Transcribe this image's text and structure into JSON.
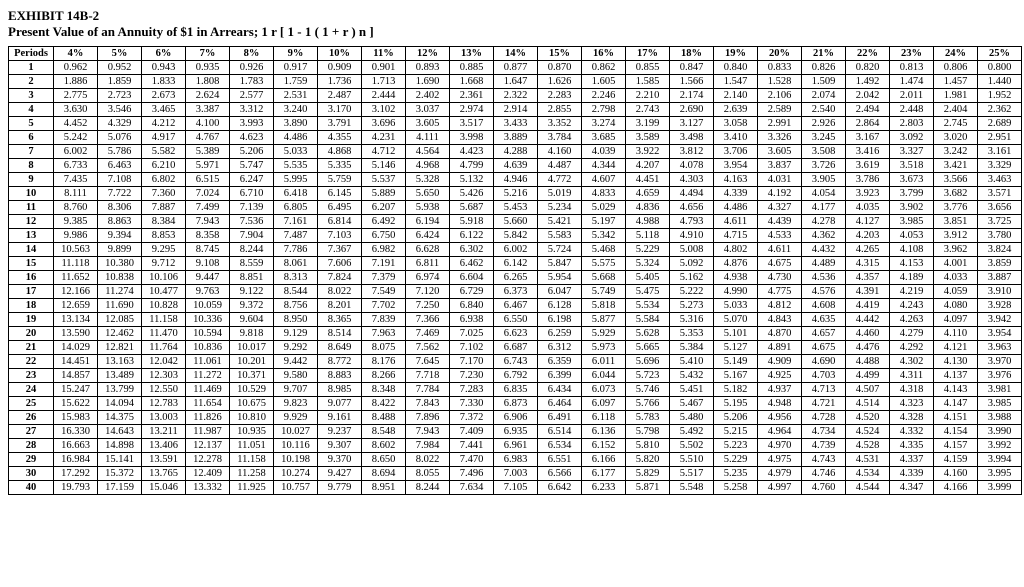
{
  "header": {
    "exhibit": "EXHIBIT 14B-2",
    "title": "Present Value of an Annuity of $1 in Arrears; 1 r [ 1 - 1 ( 1 + r ) n ]"
  },
  "table": {
    "periods_label": "Periods",
    "rates": [
      "4%",
      "5%",
      "6%",
      "7%",
      "8%",
      "9%",
      "10%",
      "11%",
      "12%",
      "13%",
      "14%",
      "15%",
      "16%",
      "17%",
      "18%",
      "19%",
      "20%",
      "21%",
      "22%",
      "23%",
      "24%",
      "25%"
    ],
    "periods": [
      1,
      2,
      3,
      4,
      5,
      6,
      7,
      8,
      9,
      10,
      11,
      12,
      13,
      14,
      15,
      16,
      17,
      18,
      19,
      20,
      21,
      22,
      23,
      24,
      25,
      26,
      27,
      28,
      29,
      30,
      40
    ],
    "rows": {
      "1": [
        "0.962",
        "0.952",
        "0.943",
        "0.935",
        "0.926",
        "0.917",
        "0.909",
        "0.901",
        "0.893",
        "0.885",
        "0.877",
        "0.870",
        "0.862",
        "0.855",
        "0.847",
        "0.840",
        "0.833",
        "0.826",
        "0.820",
        "0.813",
        "0.806",
        "0.800"
      ],
      "2": [
        "1.886",
        "1.859",
        "1.833",
        "1.808",
        "1.783",
        "1.759",
        "1.736",
        "1.713",
        "1.690",
        "1.668",
        "1.647",
        "1.626",
        "1.605",
        "1.585",
        "1.566",
        "1.547",
        "1.528",
        "1.509",
        "1.492",
        "1.474",
        "1.457",
        "1.440"
      ],
      "3": [
        "2.775",
        "2.723",
        "2.673",
        "2.624",
        "2.577",
        "2.531",
        "2.487",
        "2.444",
        "2.402",
        "2.361",
        "2.322",
        "2.283",
        "2.246",
        "2.210",
        "2.174",
        "2.140",
        "2.106",
        "2.074",
        "2.042",
        "2.011",
        "1.981",
        "1.952"
      ],
      "4": [
        "3.630",
        "3.546",
        "3.465",
        "3.387",
        "3.312",
        "3.240",
        "3.170",
        "3.102",
        "3.037",
        "2.974",
        "2.914",
        "2.855",
        "2.798",
        "2.743",
        "2.690",
        "2.639",
        "2.589",
        "2.540",
        "2.494",
        "2.448",
        "2.404",
        "2.362"
      ],
      "5": [
        "4.452",
        "4.329",
        "4.212",
        "4.100",
        "3.993",
        "3.890",
        "3.791",
        "3.696",
        "3.605",
        "3.517",
        "3.433",
        "3.352",
        "3.274",
        "3.199",
        "3.127",
        "3.058",
        "2.991",
        "2.926",
        "2.864",
        "2.803",
        "2.745",
        "2.689"
      ],
      "6": [
        "5.242",
        "5.076",
        "4.917",
        "4.767",
        "4.623",
        "4.486",
        "4.355",
        "4.231",
        "4.111",
        "3.998",
        "3.889",
        "3.784",
        "3.685",
        "3.589",
        "3.498",
        "3.410",
        "3.326",
        "3.245",
        "3.167",
        "3.092",
        "3.020",
        "2.951"
      ],
      "7": [
        "6.002",
        "5.786",
        "5.582",
        "5.389",
        "5.206",
        "5.033",
        "4.868",
        "4.712",
        "4.564",
        "4.423",
        "4.288",
        "4.160",
        "4.039",
        "3.922",
        "3.812",
        "3.706",
        "3.605",
        "3.508",
        "3.416",
        "3.327",
        "3.242",
        "3.161"
      ],
      "8": [
        "6.733",
        "6.463",
        "6.210",
        "5.971",
        "5.747",
        "5.535",
        "5.335",
        "5.146",
        "4.968",
        "4.799",
        "4.639",
        "4.487",
        "4.344",
        "4.207",
        "4.078",
        "3.954",
        "3.837",
        "3.726",
        "3.619",
        "3.518",
        "3.421",
        "3.329"
      ],
      "9": [
        "7.435",
        "7.108",
        "6.802",
        "6.515",
        "6.247",
        "5.995",
        "5.759",
        "5.537",
        "5.328",
        "5.132",
        "4.946",
        "4.772",
        "4.607",
        "4.451",
        "4.303",
        "4.163",
        "4.031",
        "3.905",
        "3.786",
        "3.673",
        "3.566",
        "3.463"
      ],
      "10": [
        "8.111",
        "7.722",
        "7.360",
        "7.024",
        "6.710",
        "6.418",
        "6.145",
        "5.889",
        "5.650",
        "5.426",
        "5.216",
        "5.019",
        "4.833",
        "4.659",
        "4.494",
        "4.339",
        "4.192",
        "4.054",
        "3.923",
        "3.799",
        "3.682",
        "3.571"
      ],
      "11": [
        "8.760",
        "8.306",
        "7.887",
        "7.499",
        "7.139",
        "6.805",
        "6.495",
        "6.207",
        "5.938",
        "5.687",
        "5.453",
        "5.234",
        "5.029",
        "4.836",
        "4.656",
        "4.486",
        "4.327",
        "4.177",
        "4.035",
        "3.902",
        "3.776",
        "3.656"
      ],
      "12": [
        "9.385",
        "8.863",
        "8.384",
        "7.943",
        "7.536",
        "7.161",
        "6.814",
        "6.492",
        "6.194",
        "5.918",
        "5.660",
        "5.421",
        "5.197",
        "4.988",
        "4.793",
        "4.611",
        "4.439",
        "4.278",
        "4.127",
        "3.985",
        "3.851",
        "3.725"
      ],
      "13": [
        "9.986",
        "9.394",
        "8.853",
        "8.358",
        "7.904",
        "7.487",
        "7.103",
        "6.750",
        "6.424",
        "6.122",
        "5.842",
        "5.583",
        "5.342",
        "5.118",
        "4.910",
        "4.715",
        "4.533",
        "4.362",
        "4.203",
        "4.053",
        "3.912",
        "3.780"
      ],
      "14": [
        "10.563",
        "9.899",
        "9.295",
        "8.745",
        "8.244",
        "7.786",
        "7.367",
        "6.982",
        "6.628",
        "6.302",
        "6.002",
        "5.724",
        "5.468",
        "5.229",
        "5.008",
        "4.802",
        "4.611",
        "4.432",
        "4.265",
        "4.108",
        "3.962",
        "3.824"
      ],
      "15": [
        "11.118",
        "10.380",
        "9.712",
        "9.108",
        "8.559",
        "8.061",
        "7.606",
        "7.191",
        "6.811",
        "6.462",
        "6.142",
        "5.847",
        "5.575",
        "5.324",
        "5.092",
        "4.876",
        "4.675",
        "4.489",
        "4.315",
        "4.153",
        "4.001",
        "3.859"
      ],
      "16": [
        "11.652",
        "10.838",
        "10.106",
        "9.447",
        "8.851",
        "8.313",
        "7.824",
        "7.379",
        "6.974",
        "6.604",
        "6.265",
        "5.954",
        "5.668",
        "5.405",
        "5.162",
        "4.938",
        "4.730",
        "4.536",
        "4.357",
        "4.189",
        "4.033",
        "3.887"
      ],
      "17": [
        "12.166",
        "11.274",
        "10.477",
        "9.763",
        "9.122",
        "8.544",
        "8.022",
        "7.549",
        "7.120",
        "6.729",
        "6.373",
        "6.047",
        "5.749",
        "5.475",
        "5.222",
        "4.990",
        "4.775",
        "4.576",
        "4.391",
        "4.219",
        "4.059",
        "3.910"
      ],
      "18": [
        "12.659",
        "11.690",
        "10.828",
        "10.059",
        "9.372",
        "8.756",
        "8.201",
        "7.702",
        "7.250",
        "6.840",
        "6.467",
        "6.128",
        "5.818",
        "5.534",
        "5.273",
        "5.033",
        "4.812",
        "4.608",
        "4.419",
        "4.243",
        "4.080",
        "3.928"
      ],
      "19": [
        "13.134",
        "12.085",
        "11.158",
        "10.336",
        "9.604",
        "8.950",
        "8.365",
        "7.839",
        "7.366",
        "6.938",
        "6.550",
        "6.198",
        "5.877",
        "5.584",
        "5.316",
        "5.070",
        "4.843",
        "4.635",
        "4.442",
        "4.263",
        "4.097",
        "3.942"
      ],
      "20": [
        "13.590",
        "12.462",
        "11.470",
        "10.594",
        "9.818",
        "9.129",
        "8.514",
        "7.963",
        "7.469",
        "7.025",
        "6.623",
        "6.259",
        "5.929",
        "5.628",
        "5.353",
        "5.101",
        "4.870",
        "4.657",
        "4.460",
        "4.279",
        "4.110",
        "3.954"
      ],
      "21": [
        "14.029",
        "12.821",
        "11.764",
        "10.836",
        "10.017",
        "9.292",
        "8.649",
        "8.075",
        "7.562",
        "7.102",
        "6.687",
        "6.312",
        "5.973",
        "5.665",
        "5.384",
        "5.127",
        "4.891",
        "4.675",
        "4.476",
        "4.292",
        "4.121",
        "3.963"
      ],
      "22": [
        "14.451",
        "13.163",
        "12.042",
        "11.061",
        "10.201",
        "9.442",
        "8.772",
        "8.176",
        "7.645",
        "7.170",
        "6.743",
        "6.359",
        "6.011",
        "5.696",
        "5.410",
        "5.149",
        "4.909",
        "4.690",
        "4.488",
        "4.302",
        "4.130",
        "3.970"
      ],
      "23": [
        "14.857",
        "13.489",
        "12.303",
        "11.272",
        "10.371",
        "9.580",
        "8.883",
        "8.266",
        "7.718",
        "7.230",
        "6.792",
        "6.399",
        "6.044",
        "5.723",
        "5.432",
        "5.167",
        "4.925",
        "4.703",
        "4.499",
        "4.311",
        "4.137",
        "3.976"
      ],
      "24": [
        "15.247",
        "13.799",
        "12.550",
        "11.469",
        "10.529",
        "9.707",
        "8.985",
        "8.348",
        "7.784",
        "7.283",
        "6.835",
        "6.434",
        "6.073",
        "5.746",
        "5.451",
        "5.182",
        "4.937",
        "4.713",
        "4.507",
        "4.318",
        "4.143",
        "3.981"
      ],
      "25": [
        "15.622",
        "14.094",
        "12.783",
        "11.654",
        "10.675",
        "9.823",
        "9.077",
        "8.422",
        "7.843",
        "7.330",
        "6.873",
        "6.464",
        "6.097",
        "5.766",
        "5.467",
        "5.195",
        "4.948",
        "4.721",
        "4.514",
        "4.323",
        "4.147",
        "3.985"
      ],
      "26": [
        "15.983",
        "14.375",
        "13.003",
        "11.826",
        "10.810",
        "9.929",
        "9.161",
        "8.488",
        "7.896",
        "7.372",
        "6.906",
        "6.491",
        "6.118",
        "5.783",
        "5.480",
        "5.206",
        "4.956",
        "4.728",
        "4.520",
        "4.328",
        "4.151",
        "3.988"
      ],
      "27": [
        "16.330",
        "14.643",
        "13.211",
        "11.987",
        "10.935",
        "10.027",
        "9.237",
        "8.548",
        "7.943",
        "7.409",
        "6.935",
        "6.514",
        "6.136",
        "5.798",
        "5.492",
        "5.215",
        "4.964",
        "4.734",
        "4.524",
        "4.332",
        "4.154",
        "3.990"
      ],
      "28": [
        "16.663",
        "14.898",
        "13.406",
        "12.137",
        "11.051",
        "10.116",
        "9.307",
        "8.602",
        "7.984",
        "7.441",
        "6.961",
        "6.534",
        "6.152",
        "5.810",
        "5.502",
        "5.223",
        "4.970",
        "4.739",
        "4.528",
        "4.335",
        "4.157",
        "3.992"
      ],
      "29": [
        "16.984",
        "15.141",
        "13.591",
        "12.278",
        "11.158",
        "10.198",
        "9.370",
        "8.650",
        "8.022",
        "7.470",
        "6.983",
        "6.551",
        "6.166",
        "5.820",
        "5.510",
        "5.229",
        "4.975",
        "4.743",
        "4.531",
        "4.337",
        "4.159",
        "3.994"
      ],
      "30": [
        "17.292",
        "15.372",
        "13.765",
        "12.409",
        "11.258",
        "10.274",
        "9.427",
        "8.694",
        "8.055",
        "7.496",
        "7.003",
        "6.566",
        "6.177",
        "5.829",
        "5.517",
        "5.235",
        "4.979",
        "4.746",
        "4.534",
        "4.339",
        "4.160",
        "3.995"
      ],
      "40": [
        "19.793",
        "17.159",
        "15.046",
        "13.332",
        "11.925",
        "10.757",
        "9.779",
        "8.951",
        "8.244",
        "7.634",
        "7.105",
        "6.642",
        "6.233",
        "5.871",
        "5.548",
        "5.258",
        "4.997",
        "4.760",
        "4.544",
        "4.347",
        "4.166",
        "3.999"
      ]
    }
  }
}
